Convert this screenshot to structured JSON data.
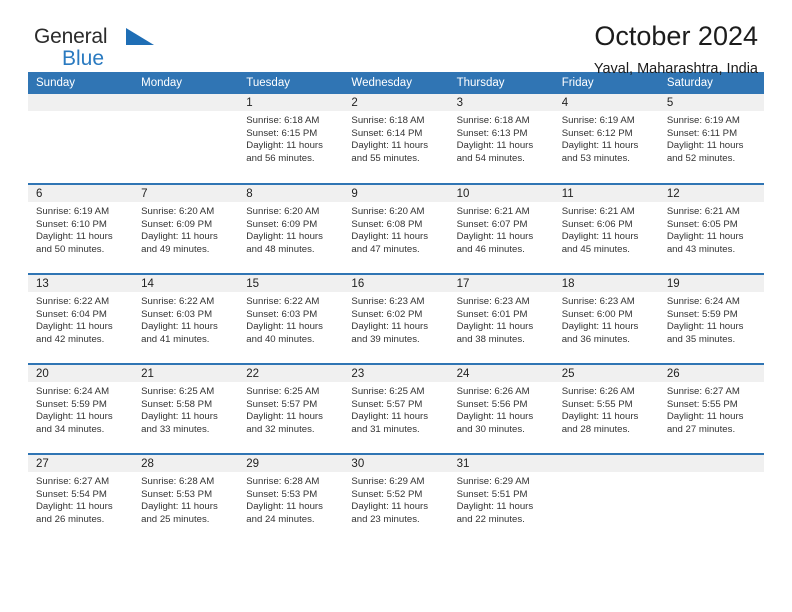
{
  "brand": {
    "name_part1": "General",
    "name_part2": "Blue",
    "triangle_color": "#1f6eb5",
    "blue_text_color": "#2a7ac0"
  },
  "header": {
    "title": "October 2024",
    "subtitle": "Yaval, Maharashtra, India"
  },
  "theme": {
    "header_blue": "#3075b4",
    "daynum_bg": "#f0f0f0",
    "text": "#333333"
  },
  "weekday_headers": [
    "Sunday",
    "Monday",
    "Tuesday",
    "Wednesday",
    "Thursday",
    "Friday",
    "Saturday"
  ],
  "labels": {
    "sunrise_prefix": "Sunrise: ",
    "sunset_prefix": "Sunset: ",
    "daylight_prefix": "Daylight: "
  },
  "weeks": [
    [
      {
        "day": "",
        "sunrise": "",
        "sunset": "",
        "daylight_line1": "",
        "daylight_line2": "",
        "blank": true
      },
      {
        "day": "",
        "sunrise": "",
        "sunset": "",
        "daylight_line1": "",
        "daylight_line2": "",
        "blank": true
      },
      {
        "day": "1",
        "sunrise": "Sunrise: 6:18 AM",
        "sunset": "Sunset: 6:15 PM",
        "daylight_line1": "Daylight: 11 hours",
        "daylight_line2": "and 56 minutes.",
        "blank": false
      },
      {
        "day": "2",
        "sunrise": "Sunrise: 6:18 AM",
        "sunset": "Sunset: 6:14 PM",
        "daylight_line1": "Daylight: 11 hours",
        "daylight_line2": "and 55 minutes.",
        "blank": false
      },
      {
        "day": "3",
        "sunrise": "Sunrise: 6:18 AM",
        "sunset": "Sunset: 6:13 PM",
        "daylight_line1": "Daylight: 11 hours",
        "daylight_line2": "and 54 minutes.",
        "blank": false
      },
      {
        "day": "4",
        "sunrise": "Sunrise: 6:19 AM",
        "sunset": "Sunset: 6:12 PM",
        "daylight_line1": "Daylight: 11 hours",
        "daylight_line2": "and 53 minutes.",
        "blank": false
      },
      {
        "day": "5",
        "sunrise": "Sunrise: 6:19 AM",
        "sunset": "Sunset: 6:11 PM",
        "daylight_line1": "Daylight: 11 hours",
        "daylight_line2": "and 52 minutes.",
        "blank": false
      }
    ],
    [
      {
        "day": "6",
        "sunrise": "Sunrise: 6:19 AM",
        "sunset": "Sunset: 6:10 PM",
        "daylight_line1": "Daylight: 11 hours",
        "daylight_line2": "and 50 minutes.",
        "blank": false
      },
      {
        "day": "7",
        "sunrise": "Sunrise: 6:20 AM",
        "sunset": "Sunset: 6:09 PM",
        "daylight_line1": "Daylight: 11 hours",
        "daylight_line2": "and 49 minutes.",
        "blank": false
      },
      {
        "day": "8",
        "sunrise": "Sunrise: 6:20 AM",
        "sunset": "Sunset: 6:09 PM",
        "daylight_line1": "Daylight: 11 hours",
        "daylight_line2": "and 48 minutes.",
        "blank": false
      },
      {
        "day": "9",
        "sunrise": "Sunrise: 6:20 AM",
        "sunset": "Sunset: 6:08 PM",
        "daylight_line1": "Daylight: 11 hours",
        "daylight_line2": "and 47 minutes.",
        "blank": false
      },
      {
        "day": "10",
        "sunrise": "Sunrise: 6:21 AM",
        "sunset": "Sunset: 6:07 PM",
        "daylight_line1": "Daylight: 11 hours",
        "daylight_line2": "and 46 minutes.",
        "blank": false
      },
      {
        "day": "11",
        "sunrise": "Sunrise: 6:21 AM",
        "sunset": "Sunset: 6:06 PM",
        "daylight_line1": "Daylight: 11 hours",
        "daylight_line2": "and 45 minutes.",
        "blank": false
      },
      {
        "day": "12",
        "sunrise": "Sunrise: 6:21 AM",
        "sunset": "Sunset: 6:05 PM",
        "daylight_line1": "Daylight: 11 hours",
        "daylight_line2": "and 43 minutes.",
        "blank": false
      }
    ],
    [
      {
        "day": "13",
        "sunrise": "Sunrise: 6:22 AM",
        "sunset": "Sunset: 6:04 PM",
        "daylight_line1": "Daylight: 11 hours",
        "daylight_line2": "and 42 minutes.",
        "blank": false
      },
      {
        "day": "14",
        "sunrise": "Sunrise: 6:22 AM",
        "sunset": "Sunset: 6:03 PM",
        "daylight_line1": "Daylight: 11 hours",
        "daylight_line2": "and 41 minutes.",
        "blank": false
      },
      {
        "day": "15",
        "sunrise": "Sunrise: 6:22 AM",
        "sunset": "Sunset: 6:03 PM",
        "daylight_line1": "Daylight: 11 hours",
        "daylight_line2": "and 40 minutes.",
        "blank": false
      },
      {
        "day": "16",
        "sunrise": "Sunrise: 6:23 AM",
        "sunset": "Sunset: 6:02 PM",
        "daylight_line1": "Daylight: 11 hours",
        "daylight_line2": "and 39 minutes.",
        "blank": false
      },
      {
        "day": "17",
        "sunrise": "Sunrise: 6:23 AM",
        "sunset": "Sunset: 6:01 PM",
        "daylight_line1": "Daylight: 11 hours",
        "daylight_line2": "and 38 minutes.",
        "blank": false
      },
      {
        "day": "18",
        "sunrise": "Sunrise: 6:23 AM",
        "sunset": "Sunset: 6:00 PM",
        "daylight_line1": "Daylight: 11 hours",
        "daylight_line2": "and 36 minutes.",
        "blank": false
      },
      {
        "day": "19",
        "sunrise": "Sunrise: 6:24 AM",
        "sunset": "Sunset: 5:59 PM",
        "daylight_line1": "Daylight: 11 hours",
        "daylight_line2": "and 35 minutes.",
        "blank": false
      }
    ],
    [
      {
        "day": "20",
        "sunrise": "Sunrise: 6:24 AM",
        "sunset": "Sunset: 5:59 PM",
        "daylight_line1": "Daylight: 11 hours",
        "daylight_line2": "and 34 minutes.",
        "blank": false
      },
      {
        "day": "21",
        "sunrise": "Sunrise: 6:25 AM",
        "sunset": "Sunset: 5:58 PM",
        "daylight_line1": "Daylight: 11 hours",
        "daylight_line2": "and 33 minutes.",
        "blank": false
      },
      {
        "day": "22",
        "sunrise": "Sunrise: 6:25 AM",
        "sunset": "Sunset: 5:57 PM",
        "daylight_line1": "Daylight: 11 hours",
        "daylight_line2": "and 32 minutes.",
        "blank": false
      },
      {
        "day": "23",
        "sunrise": "Sunrise: 6:25 AM",
        "sunset": "Sunset: 5:57 PM",
        "daylight_line1": "Daylight: 11 hours",
        "daylight_line2": "and 31 minutes.",
        "blank": false
      },
      {
        "day": "24",
        "sunrise": "Sunrise: 6:26 AM",
        "sunset": "Sunset: 5:56 PM",
        "daylight_line1": "Daylight: 11 hours",
        "daylight_line2": "and 30 minutes.",
        "blank": false
      },
      {
        "day": "25",
        "sunrise": "Sunrise: 6:26 AM",
        "sunset": "Sunset: 5:55 PM",
        "daylight_line1": "Daylight: 11 hours",
        "daylight_line2": "and 28 minutes.",
        "blank": false
      },
      {
        "day": "26",
        "sunrise": "Sunrise: 6:27 AM",
        "sunset": "Sunset: 5:55 PM",
        "daylight_line1": "Daylight: 11 hours",
        "daylight_line2": "and 27 minutes.",
        "blank": false
      }
    ],
    [
      {
        "day": "27",
        "sunrise": "Sunrise: 6:27 AM",
        "sunset": "Sunset: 5:54 PM",
        "daylight_line1": "Daylight: 11 hours",
        "daylight_line2": "and 26 minutes.",
        "blank": false
      },
      {
        "day": "28",
        "sunrise": "Sunrise: 6:28 AM",
        "sunset": "Sunset: 5:53 PM",
        "daylight_line1": "Daylight: 11 hours",
        "daylight_line2": "and 25 minutes.",
        "blank": false
      },
      {
        "day": "29",
        "sunrise": "Sunrise: 6:28 AM",
        "sunset": "Sunset: 5:53 PM",
        "daylight_line1": "Daylight: 11 hours",
        "daylight_line2": "and 24 minutes.",
        "blank": false
      },
      {
        "day": "30",
        "sunrise": "Sunrise: 6:29 AM",
        "sunset": "Sunset: 5:52 PM",
        "daylight_line1": "Daylight: 11 hours",
        "daylight_line2": "and 23 minutes.",
        "blank": false
      },
      {
        "day": "31",
        "sunrise": "Sunrise: 6:29 AM",
        "sunset": "Sunset: 5:51 PM",
        "daylight_line1": "Daylight: 11 hours",
        "daylight_line2": "and 22 minutes.",
        "blank": false
      },
      {
        "day": "",
        "sunrise": "",
        "sunset": "",
        "daylight_line1": "",
        "daylight_line2": "",
        "blank": true
      },
      {
        "day": "",
        "sunrise": "",
        "sunset": "",
        "daylight_line1": "",
        "daylight_line2": "",
        "blank": true
      }
    ]
  ]
}
